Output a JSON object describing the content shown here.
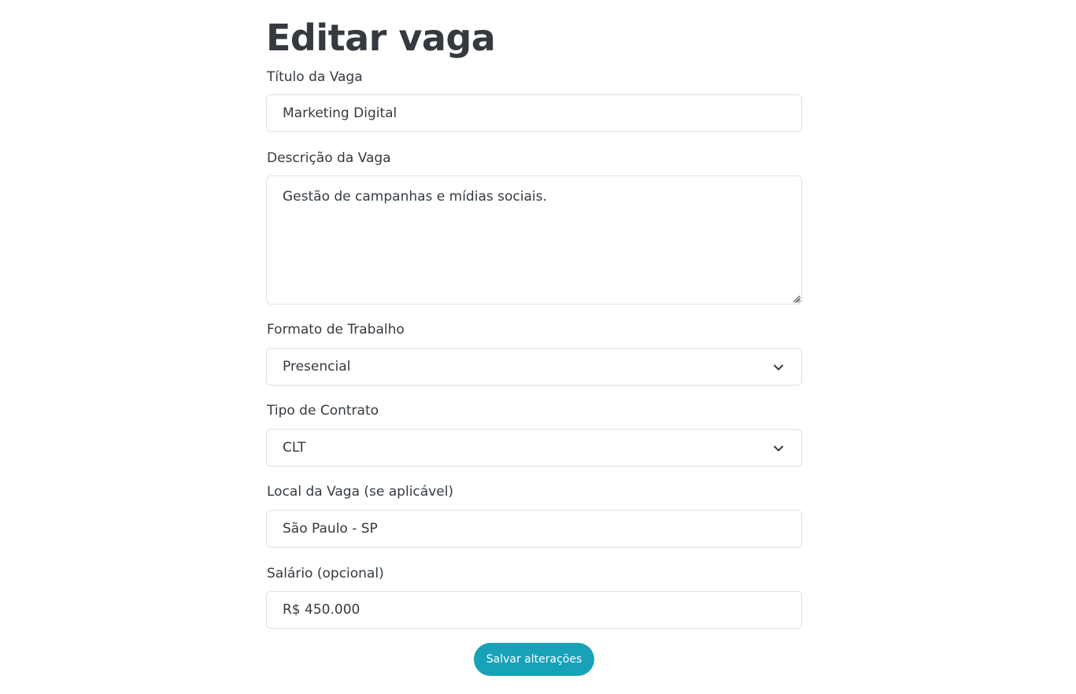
{
  "page": {
    "title": "Editar vaga"
  },
  "form": {
    "titulo": {
      "label": "Título da Vaga",
      "value": "Marketing Digital"
    },
    "descricao": {
      "label": "Descrição da Vaga",
      "value": "Gestão de campanhas e mídias sociais."
    },
    "formato": {
      "label": "Formato de Trabalho",
      "selected": "Presencial"
    },
    "contrato": {
      "label": "Tipo de Contrato",
      "selected": "CLT"
    },
    "local": {
      "label": "Local da Vaga (se aplicável)",
      "value": "São Paulo - SP"
    },
    "salario": {
      "label": "Salário (opcional)",
      "value": "R$ 450.000"
    },
    "submit_label": "Salvar alterações"
  },
  "colors": {
    "accent": "#17a2b8",
    "text": "#343a40",
    "border": "#dee2e6"
  },
  "icons": {
    "select_arrow": "chevron-down-icon",
    "textarea_grip": "resize-grip-icon"
  }
}
